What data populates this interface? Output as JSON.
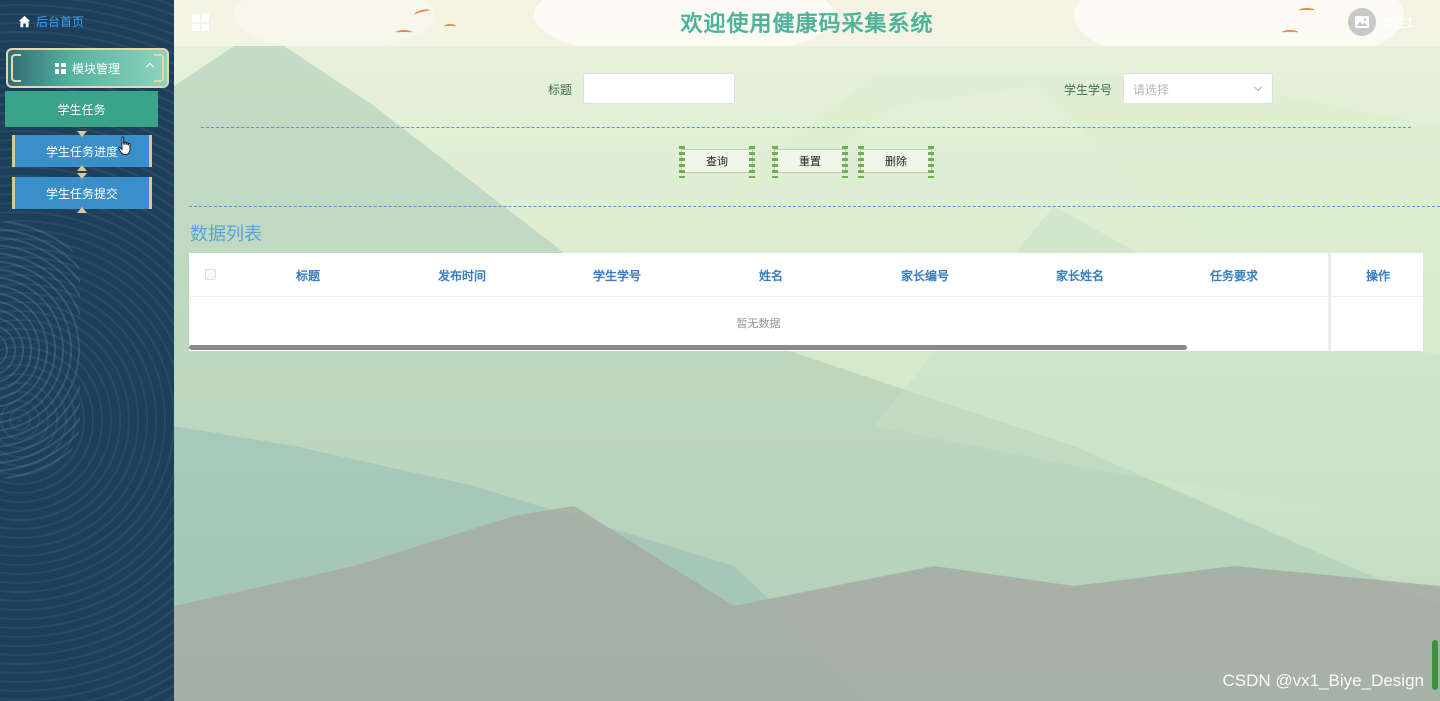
{
  "sidebar": {
    "home_label": "后台首页",
    "module_label": "模块管理",
    "items": [
      {
        "label": "学生任务"
      },
      {
        "label": "学生任务进度"
      },
      {
        "label": "学生任务提交"
      }
    ]
  },
  "header": {
    "title": "欢迎使用健康码采集系统",
    "user_name": "学生1"
  },
  "search": {
    "title_label": "标题",
    "title_value": "",
    "student_label": "学生学号",
    "student_placeholder": "请选择"
  },
  "buttons": {
    "query": "查询",
    "reset": "重置",
    "delete": "删除"
  },
  "list": {
    "section_title": "数据列表",
    "columns": [
      "标题",
      "发布时间",
      "学生学号",
      "姓名",
      "家长编号",
      "家长姓名",
      "任务要求"
    ],
    "action_column": "操作",
    "empty_text": "暂无数据"
  },
  "watermark": "CSDN @vx1_Biye_Design",
  "colors": {
    "sidebar_bg": "#1e3f5c",
    "accent_teal": "#4fb29a",
    "menu_blue": "#3a8fc9",
    "header_text": "#3a7ec2"
  }
}
